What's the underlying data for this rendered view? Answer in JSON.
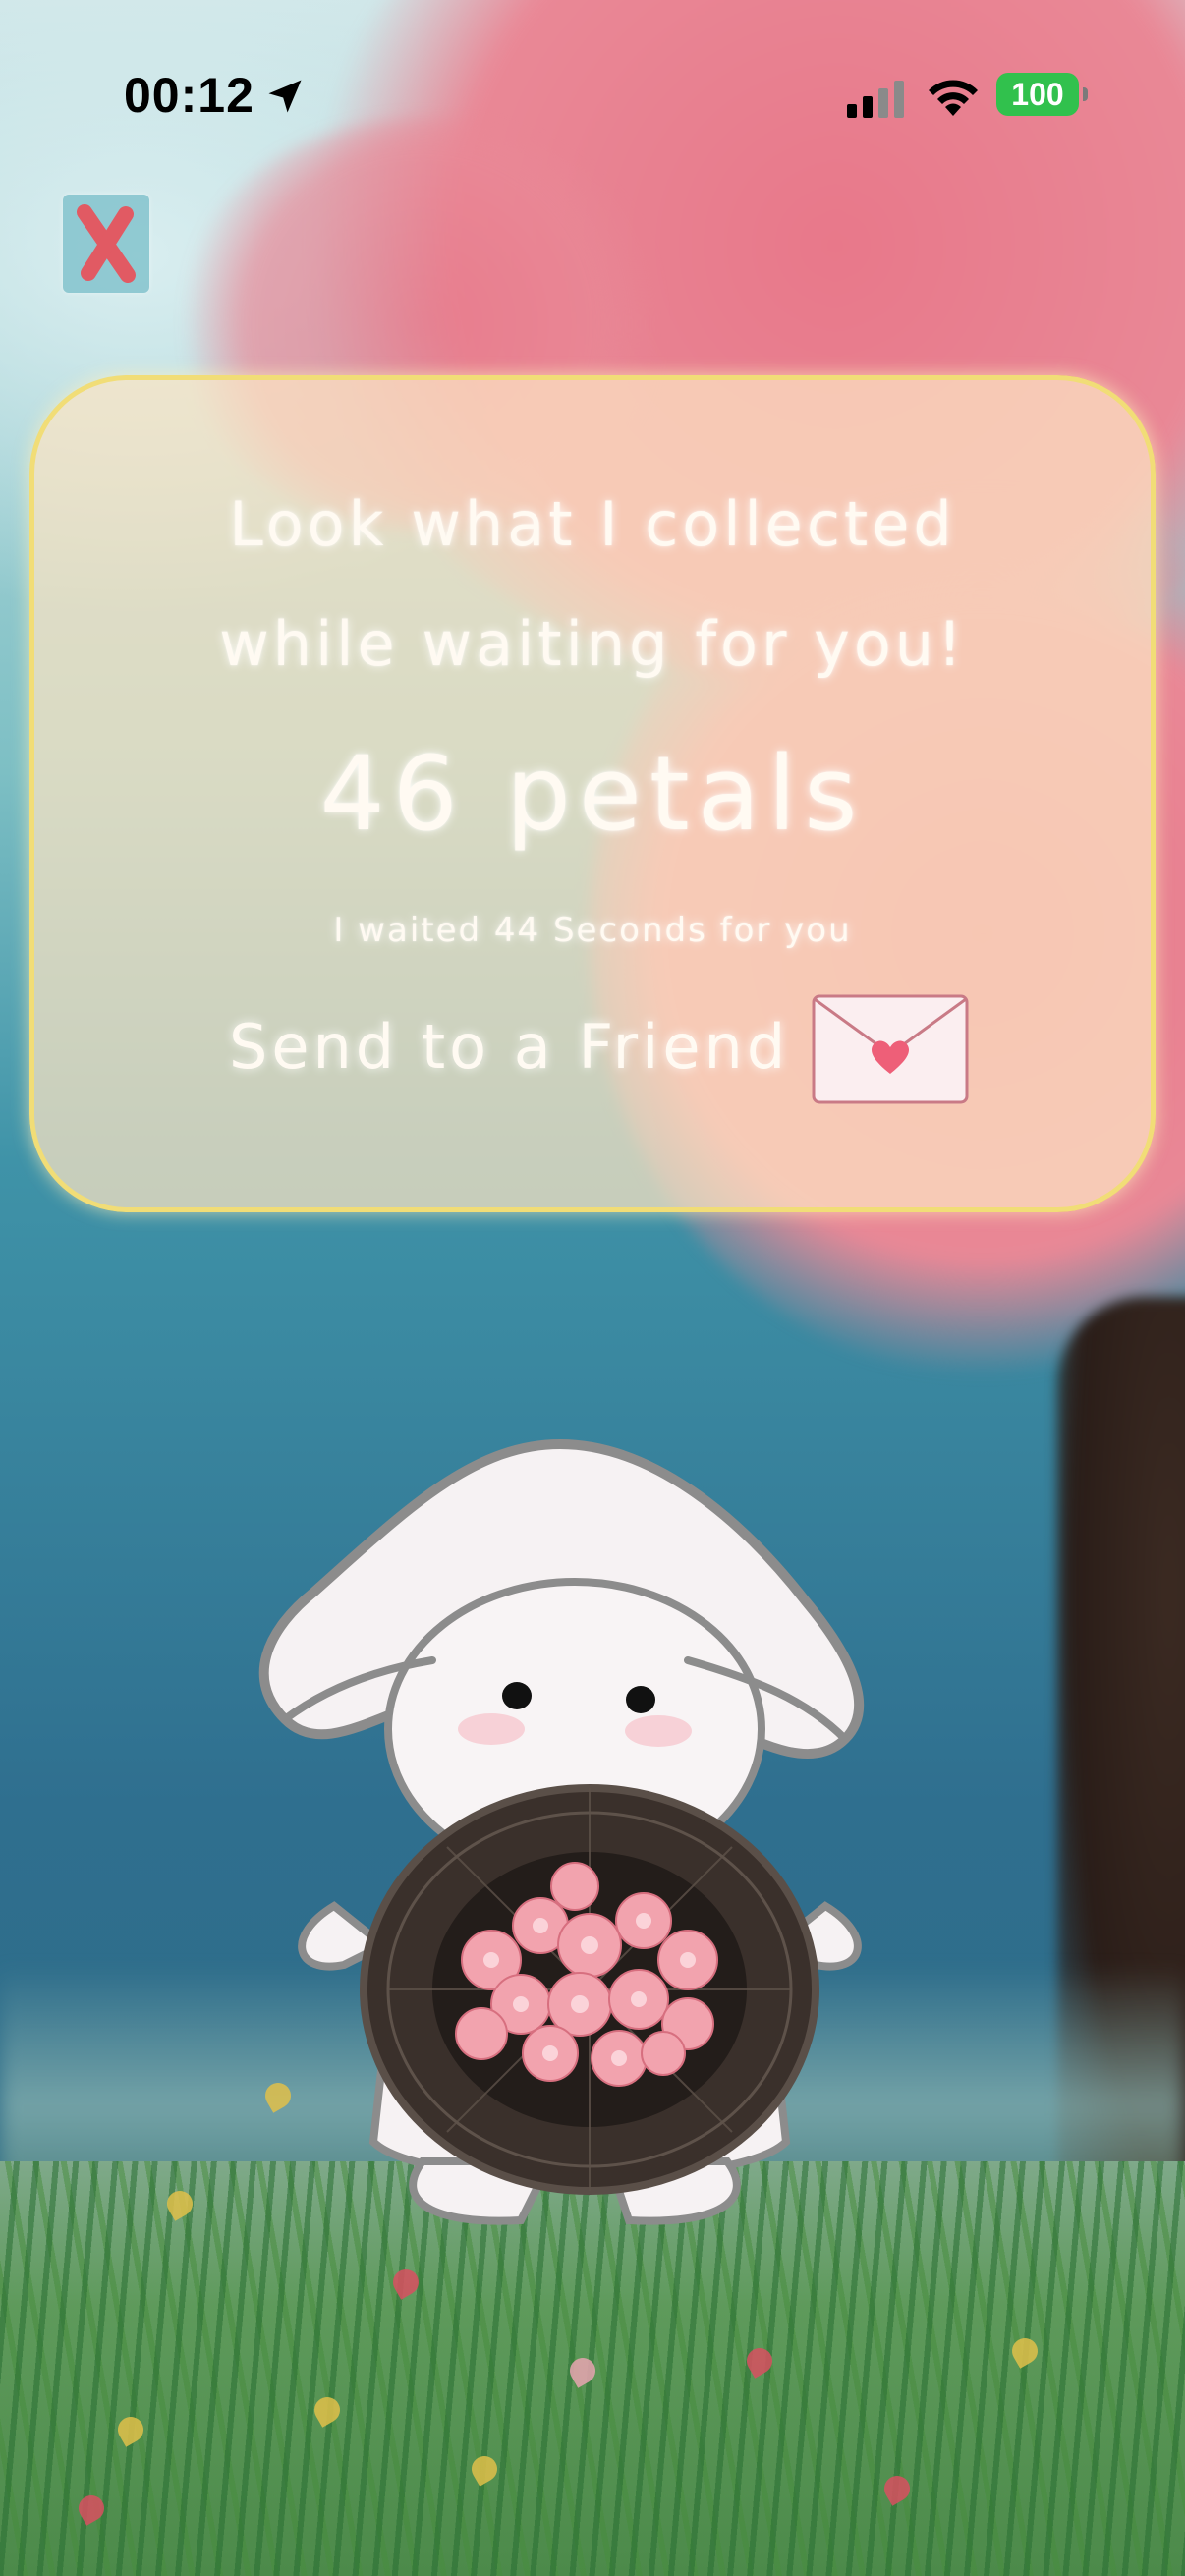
{
  "status_bar": {
    "time": "00:12",
    "battery_level": "100",
    "icons": [
      "location-arrow-icon",
      "cellular-signal-icon",
      "wifi-icon",
      "battery-icon"
    ]
  },
  "close_button": {
    "icon": "x-icon",
    "color": "#e15a63"
  },
  "card": {
    "line1": "Look what I collected",
    "line2": "while waiting for you!",
    "petal_count": "46 petals",
    "waited_text": "I waited 44 Seconds for you",
    "send_label": "Send to a Friend",
    "send_icon": "envelope-heart-icon"
  },
  "colors": {
    "card_border": "#f1dd77",
    "blossom": "#e8788a",
    "heart": "#ee5f78"
  }
}
